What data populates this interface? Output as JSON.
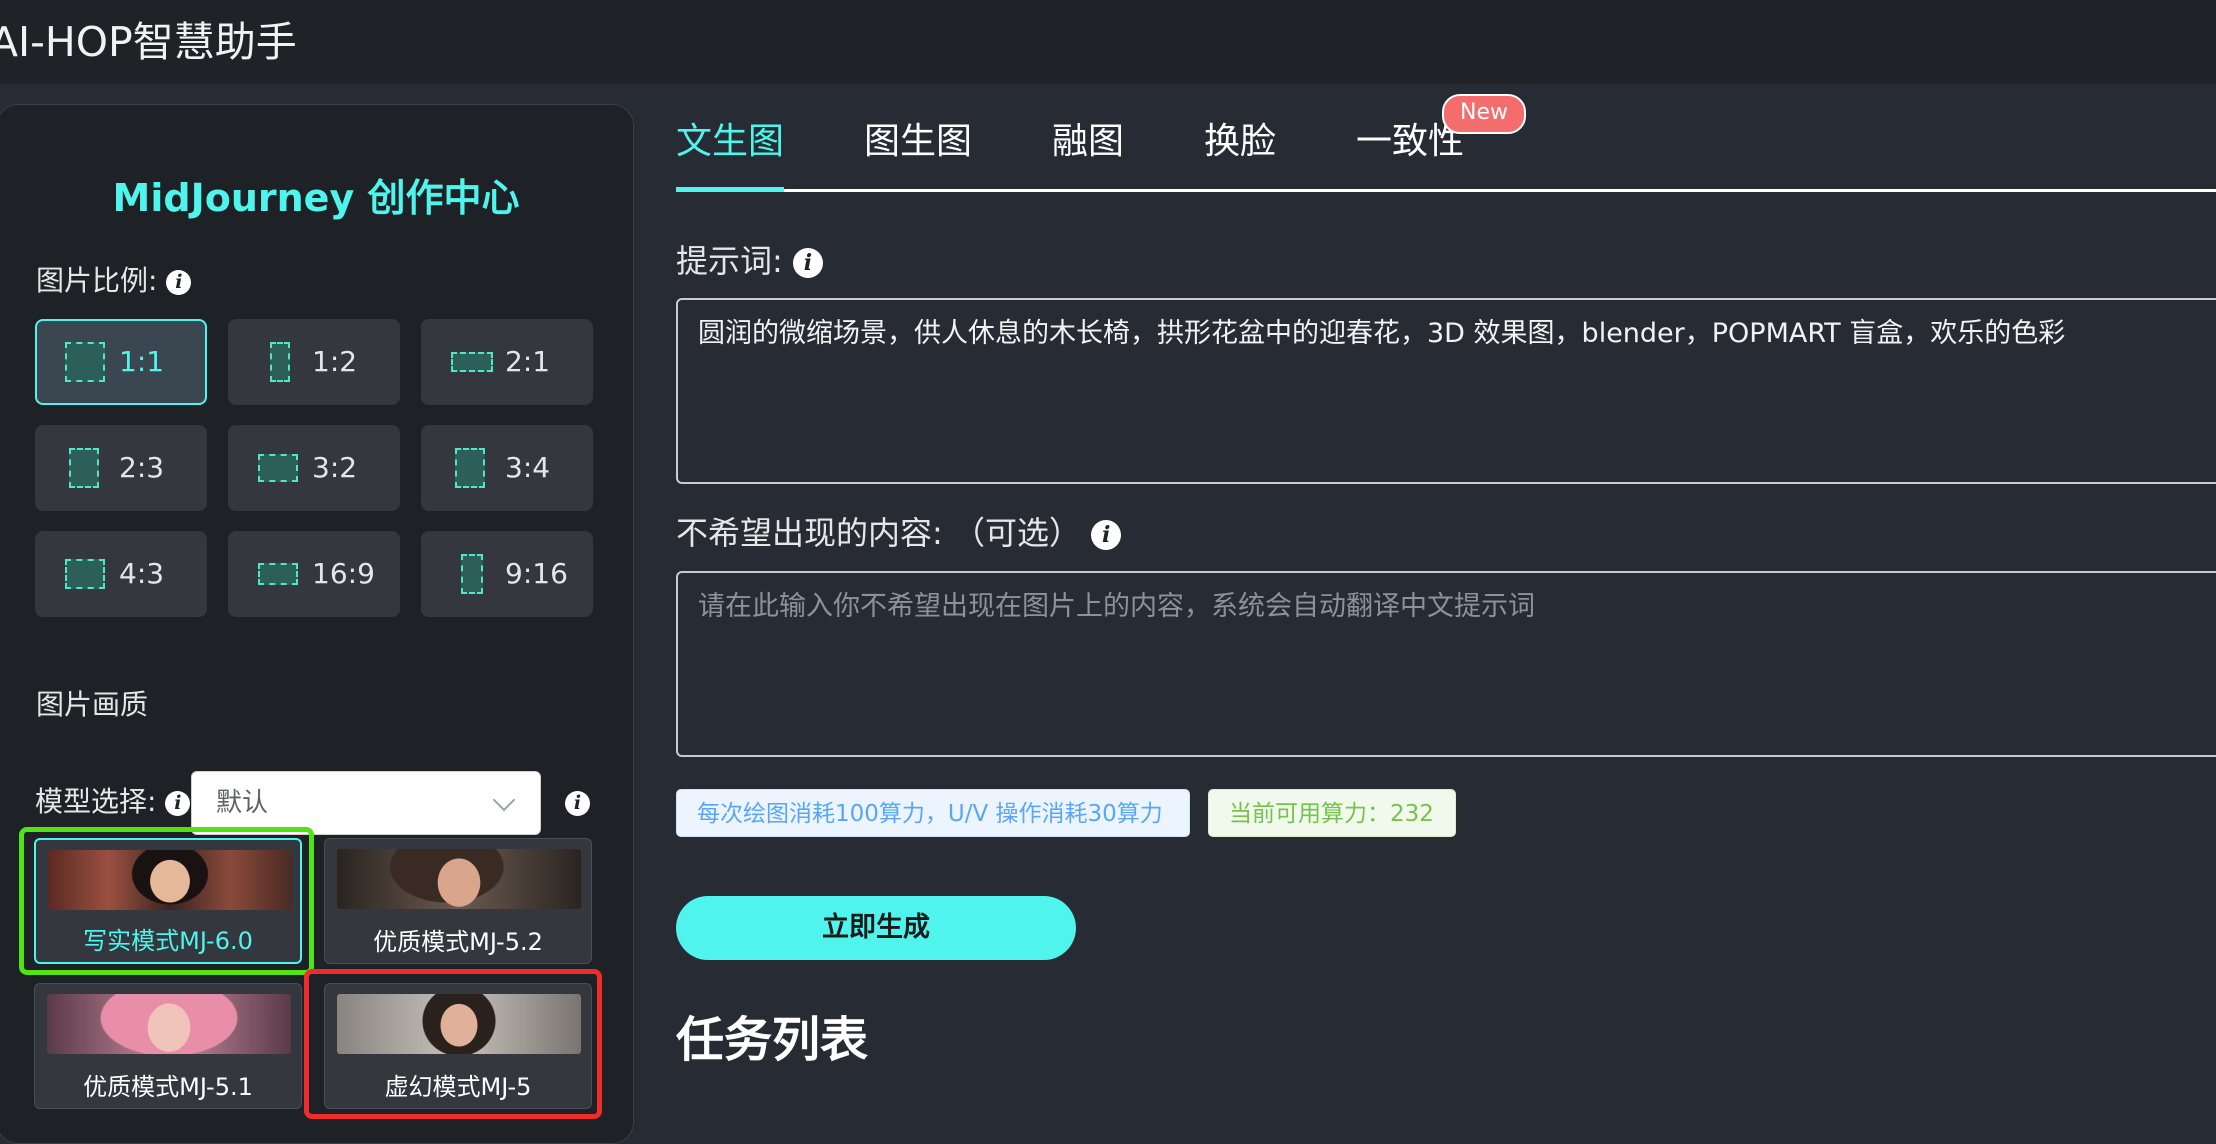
{
  "app": {
    "title": "AI-HOP智慧助手"
  },
  "sidebar": {
    "title": "MidJourney 创作中心",
    "ratio_label": "图片比例:",
    "ratios": [
      {
        "label": "1:1",
        "active": true
      },
      {
        "label": "1:2"
      },
      {
        "label": "2:1"
      },
      {
        "label": "2:3"
      },
      {
        "label": "3:2"
      },
      {
        "label": "3:4"
      },
      {
        "label": "4:3"
      },
      {
        "label": "16:9"
      },
      {
        "label": "9:16"
      }
    ],
    "quality_label": "图片画质",
    "quality_value": "默认",
    "model_label": "模型选择:",
    "models": [
      {
        "name": "写实模式MJ-6.0",
        "active": true
      },
      {
        "name": "优质模式MJ-5.2"
      },
      {
        "name": "优质模式MJ-5.1"
      },
      {
        "name": "虚幻模式MJ-5"
      }
    ]
  },
  "tabs": [
    {
      "label": "文生图",
      "active": true
    },
    {
      "label": "图生图"
    },
    {
      "label": "融图"
    },
    {
      "label": "换脸"
    },
    {
      "label": "一致性"
    }
  ],
  "new_badge": "New",
  "prompt": {
    "label": "提示词:",
    "value": "圆润的微缩场景，供人休息的木长椅，拱形花盆中的迎春花，3D 效果图，blender，POPMART 盲盒，欢乐的色彩"
  },
  "negative": {
    "label": "不希望出现的内容: （可选）",
    "placeholder": "请在此输入你不希望出现在图片上的内容，系统会自动翻译中文提示词"
  },
  "cost_note": "每次绘图消耗100算力，U/V 操作消耗30算力",
  "balance_note": "当前可用算力：232",
  "generate_label": "立即生成",
  "task_list_title": "任务列表",
  "colors": {
    "accent": "#4ff5ec",
    "highlight_green": "#52e314",
    "highlight_red": "#ee2c2c",
    "badge": "#f56c6c"
  }
}
